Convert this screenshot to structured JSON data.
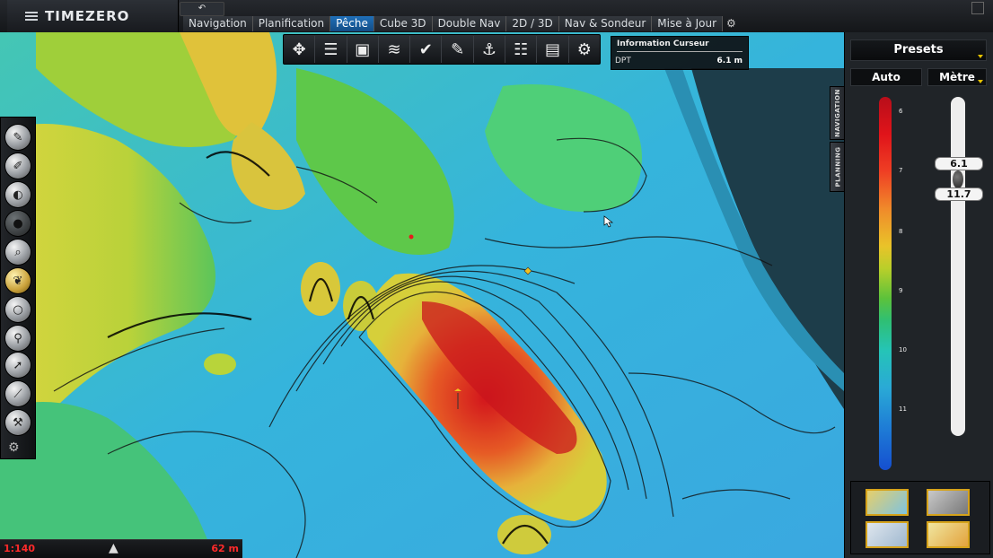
{
  "app": {
    "title": "TIMEZERO"
  },
  "tabs": [
    {
      "label": "Navigation"
    },
    {
      "label": "Planification"
    },
    {
      "label": "Pêche"
    },
    {
      "label": "Cube 3D"
    },
    {
      "label": "Double Nav"
    },
    {
      "label": "2D / 3D"
    },
    {
      "label": "Nav & Sondeur"
    },
    {
      "label": "Mise à Jour"
    }
  ],
  "active_tab": "Pêche",
  "toolbar_icons": [
    "compass-icon",
    "layers-icon",
    "chart-frame-icon",
    "sounder-icon",
    "marker-check-icon",
    "pen-icon",
    "route-icon",
    "list-icon",
    "panel-icon",
    "settings-icon"
  ],
  "cursor_info": {
    "title": "Information Curseur",
    "label": "DPT",
    "value": "6.1 m"
  },
  "left_tools": [
    "ruler-icon",
    "pencil-icon",
    "eraser-icon",
    "hidden-tool-icon",
    "zoom-icon",
    "feather-icon",
    "circle-tool-icon",
    "pin-icon",
    "pointer-icon",
    "measure-icon",
    "wrench-icon"
  ],
  "status": {
    "scale": "1:140",
    "range": "62 m"
  },
  "side_tabs": {
    "navigation": "NAVIGATION",
    "planning": "PLANNING"
  },
  "right_panel": {
    "presets_label": "Presets",
    "auto_label": "Auto",
    "unit_label": "Mètre",
    "ticks": [
      "6",
      "7",
      "8",
      "9",
      "10",
      "11"
    ],
    "slider": {
      "upper": "6.1",
      "lower": "11.7"
    }
  },
  "colors": {
    "active_tab": "#1f6fb8",
    "status_text": "#ff2a2a",
    "accent_gold": "#e5c200"
  }
}
